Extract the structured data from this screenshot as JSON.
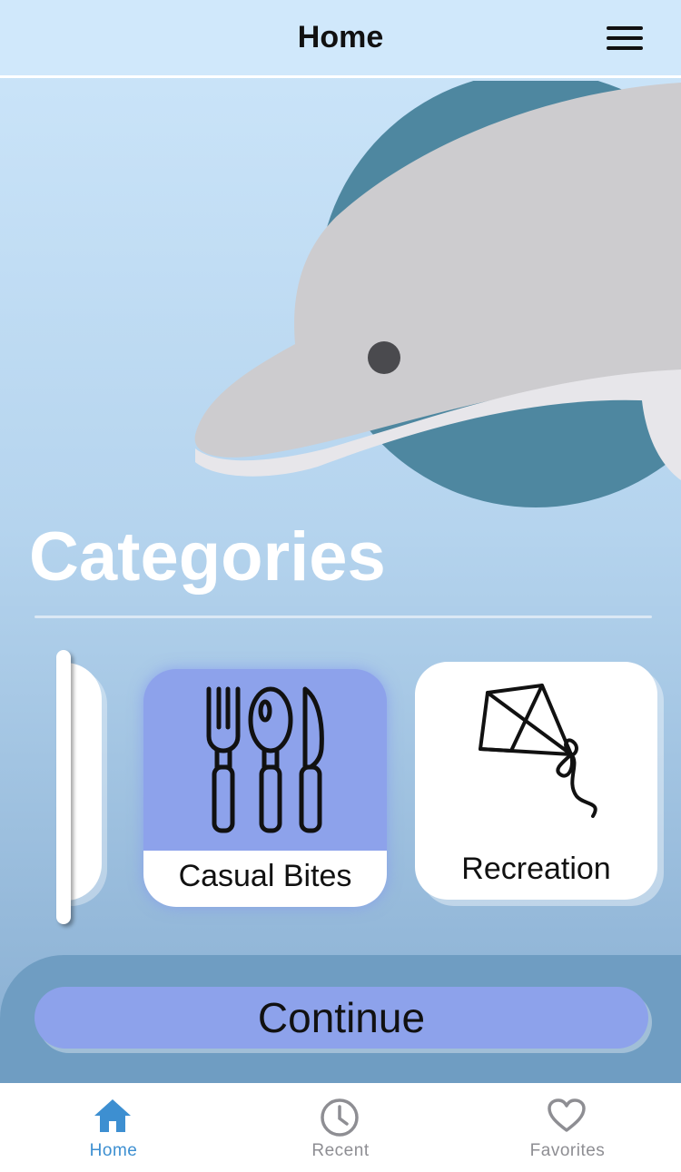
{
  "header": {
    "title": "Home",
    "menu_icon": "hamburger-menu-icon"
  },
  "hero": {
    "image": "dolphin-illustration"
  },
  "categories": {
    "title": "Categories",
    "items": [
      {
        "label": "Casual Bites",
        "icon": "fork-spoon-knife-icon",
        "selected": true
      },
      {
        "label": "Recreation",
        "icon": "kite-icon",
        "selected": false
      }
    ]
  },
  "actions": {
    "continue_label": "Continue"
  },
  "tabbar": {
    "tabs": [
      {
        "label": "Home",
        "icon": "home-icon",
        "active": true
      },
      {
        "label": "Recent",
        "icon": "clock-icon",
        "active": false
      },
      {
        "label": "Favorites",
        "icon": "heart-icon",
        "active": false
      }
    ]
  },
  "colors": {
    "accent": "#8da2eb",
    "active_tab": "#3d8fd1",
    "header_bg": "#d0e8fb",
    "bottom_panel": "#6f9dc2"
  }
}
